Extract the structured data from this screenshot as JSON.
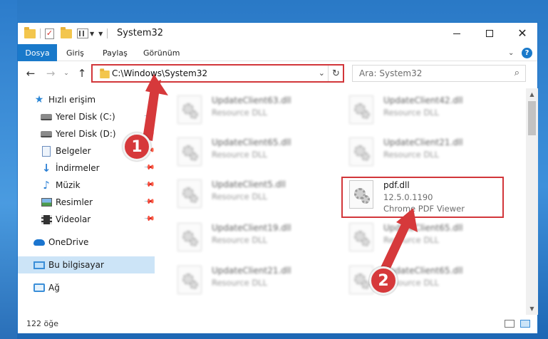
{
  "window": {
    "title": "System32"
  },
  "ribbon": {
    "tabs": [
      "Dosya",
      "Giriş",
      "Paylaş",
      "Görünüm"
    ],
    "help_glyph": "?"
  },
  "address": {
    "path": "C:\\Windows\\System32",
    "search_placeholder": "Ara: System32"
  },
  "nav": {
    "items": [
      {
        "label": "Hızlı erişim",
        "icon": "star-icon"
      },
      {
        "label": "Yerel Disk (C:)",
        "icon": "drive-icon",
        "pinned": true
      },
      {
        "label": "Yerel Disk (D:)",
        "icon": "drive-icon",
        "pinned": true
      },
      {
        "label": "Belgeler",
        "icon": "document-icon",
        "pinned": true
      },
      {
        "label": "İndirmeler",
        "icon": "download-icon",
        "pinned": true
      },
      {
        "label": "Müzik",
        "icon": "music-icon",
        "pinned": true
      },
      {
        "label": "Resimler",
        "icon": "pictures-icon",
        "pinned": true
      },
      {
        "label": "Videolar",
        "icon": "videos-icon",
        "pinned": true
      },
      {
        "label": "OneDrive",
        "icon": "cloud-icon"
      },
      {
        "label": "Bu bilgisayar",
        "icon": "computer-icon",
        "selected": true
      },
      {
        "label": "Ağ",
        "icon": "network-icon"
      }
    ]
  },
  "files": [
    {
      "name": "UpdateClient63.dll",
      "sub": "Resource DLL"
    },
    {
      "name": "UpdateClient42.dll",
      "sub": "Resource DLL"
    },
    {
      "name": "UpdateClient65.dll",
      "sub": "Resource DLL"
    },
    {
      "name": "UpdateClient21.dll",
      "sub": "Resource DLL"
    },
    {
      "name": "UpdateClient5.dll",
      "sub": "Resource DLL"
    },
    {
      "name": "pdf.dll",
      "sub": "12.5.0.1190",
      "sub2": "Chrome PDF Viewer",
      "highlighted": true
    },
    {
      "name": "UpdateClient19.dll",
      "sub": "Resource DLL"
    },
    {
      "name": "UpdateClient65.dll",
      "sub": "Resource DLL"
    },
    {
      "name": "UpdateClient21.dll",
      "sub": "Resource DLL"
    },
    {
      "name": "UpdateClient65.dll",
      "sub": "Resource DLL"
    }
  ],
  "status": {
    "count": "122 öğe"
  },
  "callouts": [
    "1",
    "2"
  ],
  "colors": {
    "accent": "#1979ca",
    "callout": "#d6393b"
  }
}
